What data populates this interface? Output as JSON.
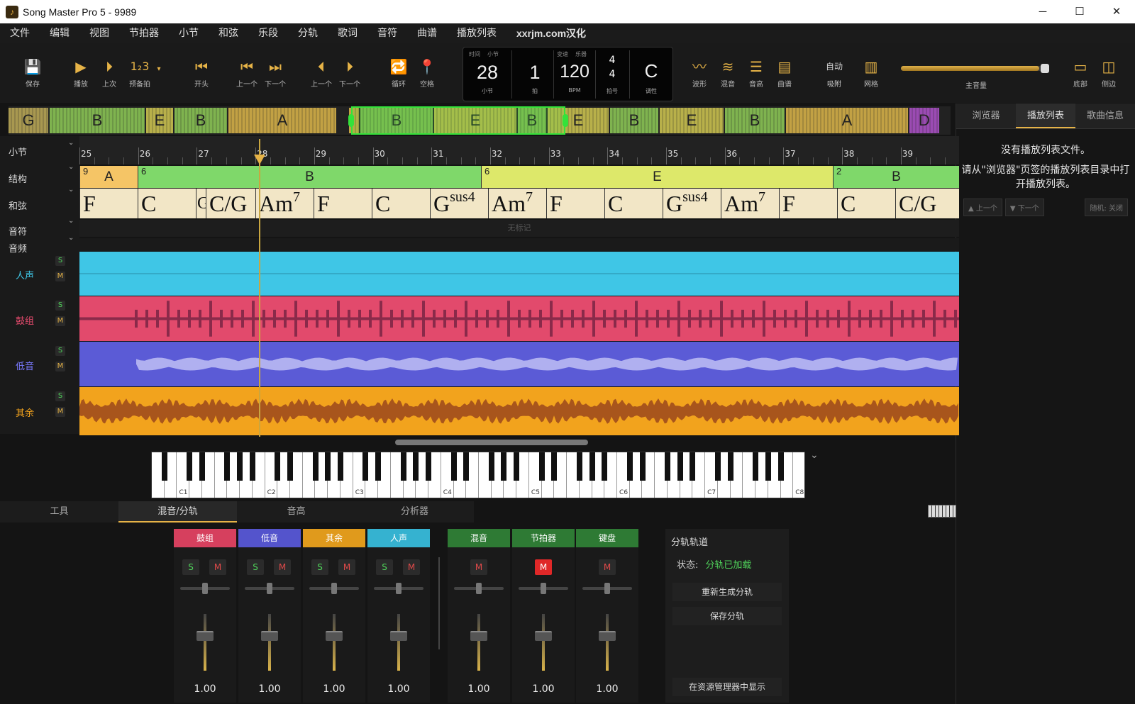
{
  "window": {
    "title": "Song Master Pro 5 - 9989",
    "minimize": "─",
    "maximize": "☐",
    "close": "✕"
  },
  "menu": [
    "文件",
    "编辑",
    "视图",
    "节拍器",
    "小节",
    "和弦",
    "乐段",
    "分轨",
    "歌词",
    "音符",
    "曲谱",
    "播放列表",
    "xxrjm.com汉化"
  ],
  "toolbar": {
    "save": "保存",
    "play": "播放",
    "last": "上次",
    "countin": "预备拍",
    "start": "开头",
    "prev_bar": "上一个",
    "next_bar": "下一个",
    "prev_sec": "上一个",
    "next_sec": "下一个",
    "loop": "循环",
    "pin": "空格",
    "waveform": "波形",
    "mix": "混音",
    "pitch": "音高",
    "score": "曲谱",
    "auto": "自动",
    "snap": "吸附",
    "grid": "网格",
    "master": "主音量",
    "bottom": "底部",
    "side": "侧边"
  },
  "lcd": {
    "time_label": "时间",
    "bar_label": "小节",
    "bar": "28",
    "bar_unit": "小节",
    "beat": "1",
    "beat_unit": "拍",
    "tempo_lbl1": "变速",
    "tempo_lbl2": "乐器",
    "bpm": "120",
    "bpm_unit": "BPM",
    "ts_top": "4",
    "ts_bottom": "4",
    "ts_unit": "拍号",
    "key": "C",
    "key_unit": "调性"
  },
  "master_volume": 0.95,
  "overview": [
    "G",
    "B",
    "E",
    "B",
    "A",
    "B",
    "E",
    "B",
    "E",
    "B",
    "E",
    "B",
    "A",
    "D"
  ],
  "side_panel": {
    "tabs": [
      "浏览器",
      "播放列表",
      "歌曲信息"
    ],
    "line1": "没有播放列表文件。",
    "line2": "请从\"浏览器\"页签的播放列表目录中打开播放列表。",
    "prev": "▲ 上一个",
    "next": "▼ 下一个",
    "random": "随机: 关闭"
  },
  "row_labels": {
    "bars": "小节",
    "structure": "结构",
    "chords": "和弦",
    "notes": "音符",
    "audio": "音频",
    "no_marks": "无标记"
  },
  "ruler": [
    "25",
    "26",
    "27",
    "28",
    "29",
    "30",
    "31",
    "32",
    "33",
    "34",
    "35",
    "36",
    "37",
    "38",
    "39"
  ],
  "structure": [
    {
      "num": "9",
      "name": "A"
    },
    {
      "num": "6",
      "name": "B"
    },
    {
      "num": "6",
      "name": "E"
    },
    {
      "num": "2",
      "name": "B"
    }
  ],
  "chords": [
    {
      "root": "F",
      "ext": ""
    },
    {
      "root": "C",
      "ext": ""
    },
    {
      "root": "G",
      "ext": ""
    },
    {
      "root": "C/G",
      "ext": ""
    },
    {
      "root": "Am",
      "ext": "7"
    },
    {
      "root": "F",
      "ext": ""
    },
    {
      "root": "C",
      "ext": ""
    },
    {
      "root": "G",
      "ext": "sus4"
    },
    {
      "root": "Am",
      "ext": "7"
    },
    {
      "root": "F",
      "ext": ""
    },
    {
      "root": "C",
      "ext": ""
    },
    {
      "root": "G",
      "ext": "sus4"
    },
    {
      "root": "Am",
      "ext": "7"
    },
    {
      "root": "F",
      "ext": ""
    },
    {
      "root": "C",
      "ext": ""
    },
    {
      "root": "C/G",
      "ext": ""
    }
  ],
  "tracks": [
    {
      "name": "人声",
      "color": "#3fc6e6"
    },
    {
      "name": "鼓组",
      "color": "#e24a6c"
    },
    {
      "name": "低音",
      "color": "#5b5bd6"
    },
    {
      "name": "其余",
      "color": "#f2a31d"
    }
  ],
  "solo": "S",
  "mute": "M",
  "octaves": [
    "C1",
    "C2",
    "C3",
    "C4",
    "C5",
    "C6",
    "C7",
    "C8"
  ],
  "bottom_tabs": [
    "工具",
    "混音/分轨",
    "音高",
    "分析器"
  ],
  "mixer": [
    {
      "name": "鼓组",
      "color": "#d6405e",
      "value": "1.00",
      "solo": true
    },
    {
      "name": "低音",
      "color": "#5454cc",
      "value": "1.00",
      "solo": true
    },
    {
      "name": "其余",
      "color": "#e09a1c",
      "value": "1.00",
      "solo": true
    },
    {
      "name": "人声",
      "color": "#35b2d0",
      "value": "1.00",
      "solo": true
    },
    {
      "name": "混音",
      "color": "#2e7a34",
      "value": "1.00",
      "solo": false
    },
    {
      "name": "节拍器",
      "color": "#2e7a34",
      "value": "1.00",
      "solo": false,
      "muted": true
    },
    {
      "name": "键盘",
      "color": "#2e7a34",
      "value": "1.00",
      "solo": false
    }
  ],
  "stem": {
    "title": "分轨轨道",
    "status_label": "状态:",
    "status": "分轨已加载",
    "regen": "重新生成分轨",
    "save": "保存分轨",
    "show": "在资源管理器中显示"
  }
}
